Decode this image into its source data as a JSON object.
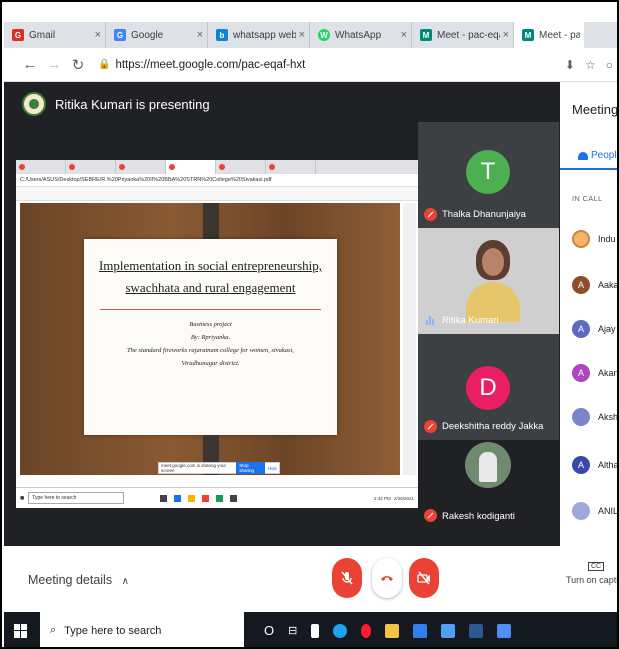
{
  "browser": {
    "tabs": [
      {
        "label": "Gmail",
        "favicon": "G",
        "favicon_color": "#d93025",
        "active": false
      },
      {
        "label": "Google",
        "favicon": "G",
        "favicon_color": "#4285f4",
        "active": false
      },
      {
        "label": "whatsapp web - Bing",
        "favicon": "b",
        "favicon_color": "#0a84d6",
        "active": false
      },
      {
        "label": "WhatsApp",
        "favicon": "W",
        "favicon_color": "#25d366",
        "active": false
      },
      {
        "label": "Meet - pac-eqaf-h",
        "favicon": "M",
        "favicon_color": "#00897b",
        "active": false
      },
      {
        "label": "Meet - pac-eqaf",
        "favicon": "M",
        "favicon_color": "#00897b",
        "active": true
      }
    ],
    "url": "https://meet.google.com/pac-eqaf-hxt"
  },
  "meet": {
    "presenter_text": "Ritika Kumari is presenting",
    "shared_slide": {
      "title": "Implementation in social entrepreneurship, swachhata and rural engagement",
      "lines": [
        "Business project",
        "By: Rpriyanka.",
        "The standard fireworks rajaratnam college for women, sivakasi,",
        "Virudhunagar district."
      ],
      "shared_url": "C:/Users/ASUS/Desktop/SEBRE/R.%20Priyanka%20II%20BBA%20STRN%20College%20Sivakasi.pdf",
      "share_notice": "meet.google.com is sharing your screen",
      "stop_sharing_label": "Stop sharing",
      "hide_label": "Hide",
      "taskbar_search": "Type here to search",
      "taskbar_time": "2:42 PM",
      "taskbar_date": "2/26/2021"
    },
    "participants": [
      {
        "name": "Thalka Dhanunjaiya",
        "initial": "T",
        "color": "#4caf50",
        "muted": true
      },
      {
        "name": "Ritika Kumari",
        "initial": "",
        "color": "",
        "muted": false,
        "video": true
      },
      {
        "name": "Deekshitha reddy Jakka",
        "initial": "D",
        "color": "#e91e63",
        "muted": true
      },
      {
        "name": "Rakesh kodiganti",
        "initial": "",
        "color": "",
        "muted": true,
        "video": true
      }
    ],
    "panel": {
      "title": "Meeting details",
      "people_tab": "People",
      "in_call_label": "IN CALL",
      "people": [
        {
          "name": "Indu",
          "initial": "",
          "color": "#f6b26b"
        },
        {
          "name": "Aakash",
          "initial": "A",
          "color": "#8d4e2c"
        },
        {
          "name": "Ajay",
          "initial": "A",
          "color": "#5c6bc0"
        },
        {
          "name": "Akanksha",
          "initial": "A",
          "color": "#ab47bc"
        },
        {
          "name": "Akshay",
          "initial": "",
          "color": "#7986cb"
        },
        {
          "name": "Althaf",
          "initial": "A",
          "color": "#3949ab"
        },
        {
          "name": "ANIL",
          "initial": "",
          "color": "#9fa8da"
        }
      ]
    }
  },
  "controls": {
    "meeting_details": "Meeting details",
    "captions_label": "Turn on captions",
    "cc_icon_text": "CC"
  },
  "taskbar": {
    "search_placeholder": "Type here to search"
  }
}
